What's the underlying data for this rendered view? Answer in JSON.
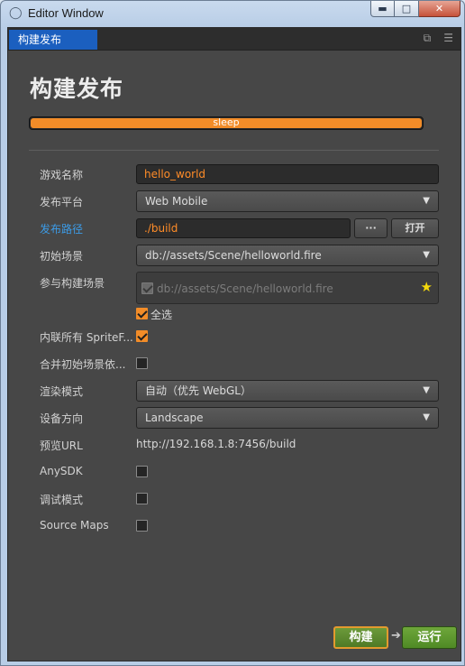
{
  "window": {
    "title": "Editor Window",
    "app_icon": "cocos-logo-icon"
  },
  "window_controls": {
    "minimize": "minimize-icon",
    "maximize": "maximize-icon",
    "close": "close-icon"
  },
  "tab": {
    "label": "构建发布",
    "tools": [
      "popout-icon",
      "menu-icon"
    ]
  },
  "heading": "构建发布",
  "progress": {
    "text": "sleep",
    "percent": 100,
    "color": "#f28c28"
  },
  "form": {
    "game_name": {
      "label": "游戏名称",
      "value": "hello_world"
    },
    "platform": {
      "label": "发布平台",
      "value": "Web Mobile"
    },
    "build_path": {
      "label": "发布路径",
      "value": "./build",
      "browse_label": "···",
      "open_label": "打开"
    },
    "start_scene": {
      "label": "初始场景",
      "value": "db://assets/Scene/helloworld.fire"
    },
    "build_scenes": {
      "label": "参与构建场景",
      "scene": "db://assets/Scene/helloworld.fire",
      "select_all": "全选",
      "select_all_checked": true
    },
    "inline_sprites": {
      "label": "内联所有 SpriteF...",
      "checked": true
    },
    "merge_start_scene": {
      "label": "合并初始场景依...",
      "checked": false
    },
    "render_mode": {
      "label": "渲染模式",
      "value": "自动（优先 WebGL）"
    },
    "orientation": {
      "label": "设备方向",
      "value": "Landscape"
    },
    "preview_url": {
      "label": "预览URL",
      "value": "http://192.168.1.8:7456/build"
    },
    "anysdk": {
      "label": "AnySDK",
      "checked": false
    },
    "debug_mode": {
      "label": "调试模式",
      "checked": false
    },
    "source_maps": {
      "label": "Source Maps",
      "checked": false
    }
  },
  "actions": {
    "build": "构建",
    "run": "运行"
  },
  "colors": {
    "accent": "#f28c28",
    "tab_active": "#1b5fbf",
    "link_label": "#3c9be6",
    "run_green": "#5a9a2e"
  }
}
